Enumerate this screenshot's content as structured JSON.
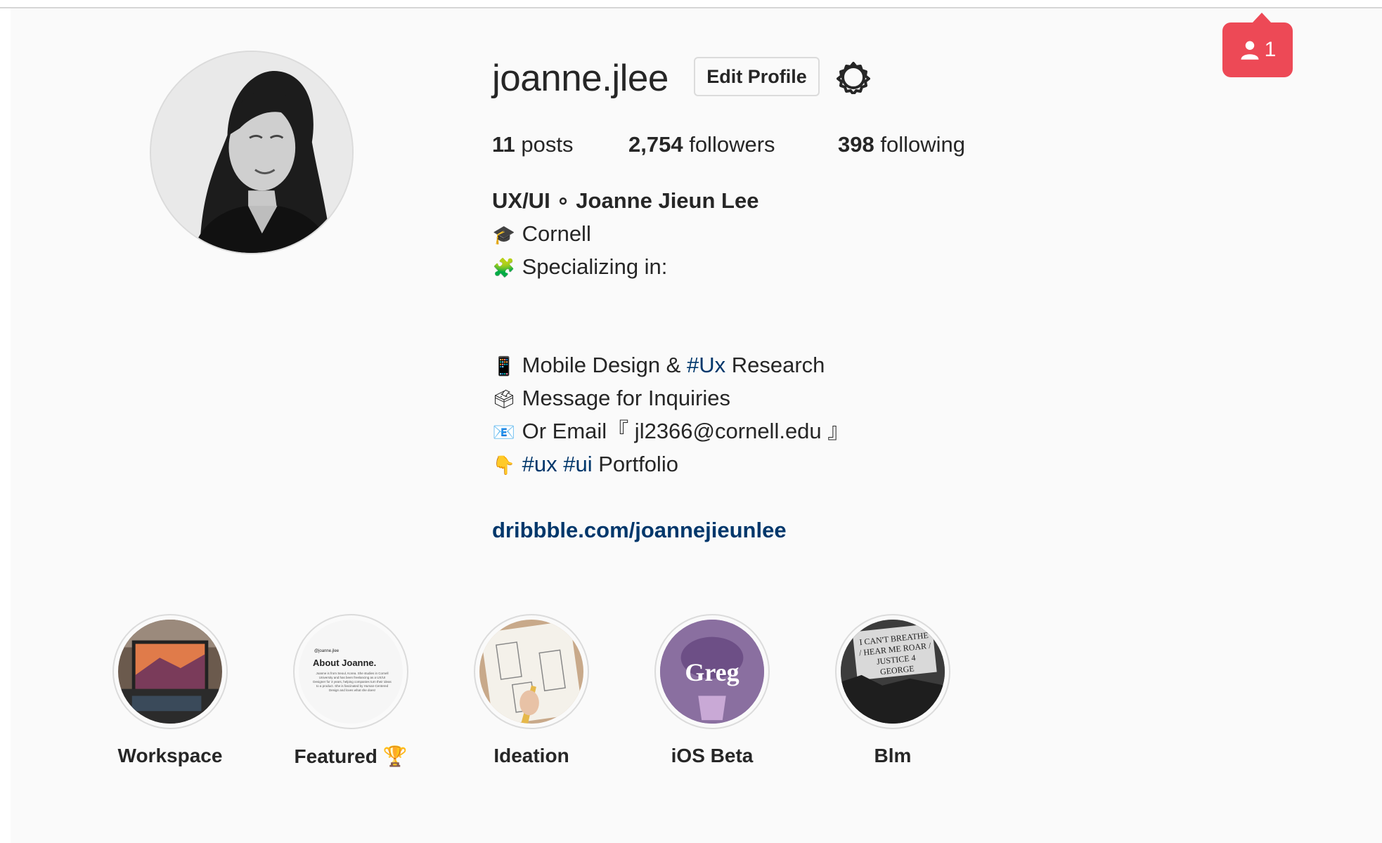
{
  "profile": {
    "username": "joanne.jlee",
    "edit_label": "Edit Profile",
    "posts_count": "11",
    "posts_label": "posts",
    "followers_count": "2,754",
    "followers_label": "followers",
    "following_count": "398",
    "following_label": "following"
  },
  "bio": {
    "name": "UX/UI ∘ Joanne Jieun Lee",
    "line1_emoji": "🎓",
    "line1_text": "Cornell",
    "line2_emoji": "🧩",
    "line2_text": "Specializing in:",
    "line3_emoji": "📱",
    "line3_pre": "Mobile Design & ",
    "line3_tag": "#Ux",
    "line3_post": " Research",
    "line4_emoji": "🗳",
    "line4_text": "Message for Inquiries",
    "line5_emoji": "📧",
    "line5_text": "Or Email『 jl2366@cornell.edu 』",
    "line6_emoji": "👇",
    "line6_tag1": "#ux",
    "line6_tag2": "#ui",
    "line6_post": " Portfolio",
    "link": "dribbble.com/joannejieunlee"
  },
  "notification": {
    "count": "1",
    "icon": "person-icon",
    "color": "#ed4956"
  },
  "highlights": [
    {
      "label": "Workspace"
    },
    {
      "label": "Featured 🏆"
    },
    {
      "label": "Ideation"
    },
    {
      "label": "iOS Beta",
      "image_text": "Greg"
    },
    {
      "label": "Blm",
      "image_text": "I CAN'T BREATHE / HEAR ME ROAR / JUSTICE 4 GEORGE"
    }
  ],
  "featured_image": {
    "handle": "@joanne.jlee",
    "title": "About Joanne.",
    "body": "Joanne is from Seoul, Korea. She studies in Cornell University and has been freelancing as a UX/UI Designer for 3 years, helping companies turn their ideas to a product. She is fascinated by Human-Centered Design and loves what she does!"
  },
  "colors": {
    "link": "#00376b",
    "border": "#dbdbdb",
    "background": "#fafafa"
  }
}
